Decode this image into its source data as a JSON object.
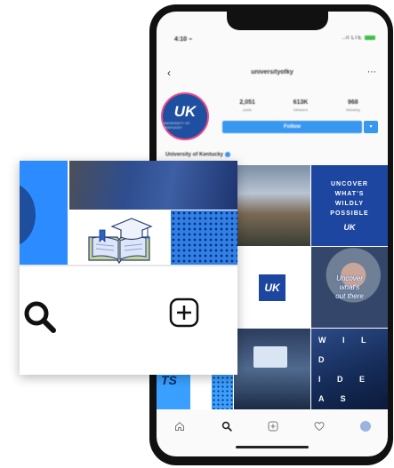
{
  "status_bar": {
    "time": "4:10 ⌁",
    "signals": "..ıl LTE"
  },
  "profile": {
    "username": "universityofky",
    "avatar_logo": "UK",
    "avatar_subtitle": "UNIVERSITY OF KENTUCKY",
    "stats": [
      {
        "value": "2,051",
        "label": "posts"
      },
      {
        "value": "613K",
        "label": "followers"
      },
      {
        "value": "968",
        "label": "following"
      }
    ],
    "follow_label": "Follow",
    "bio_name": "University of Kentucky"
  },
  "grid": {
    "uncover_lines": [
      "UNCOVER",
      "WHAT'S",
      "WILDLY",
      "POSSIBLE"
    ],
    "uncover_logo": "UK",
    "uk_logo": "UK",
    "student_quote": [
      "Uncover",
      "what's",
      "out there"
    ],
    "ts_text": "TS",
    "wild_lines": [
      "W I L D",
      "I D E A S"
    ]
  },
  "tabbar": [
    "home-icon",
    "search-icon",
    "add-icon",
    "heart-icon",
    "profile-icon"
  ],
  "colors": {
    "uk_blue": "#1d46a0",
    "instagram_blue": "#3897f0",
    "bright_blue": "#2c8cff"
  }
}
